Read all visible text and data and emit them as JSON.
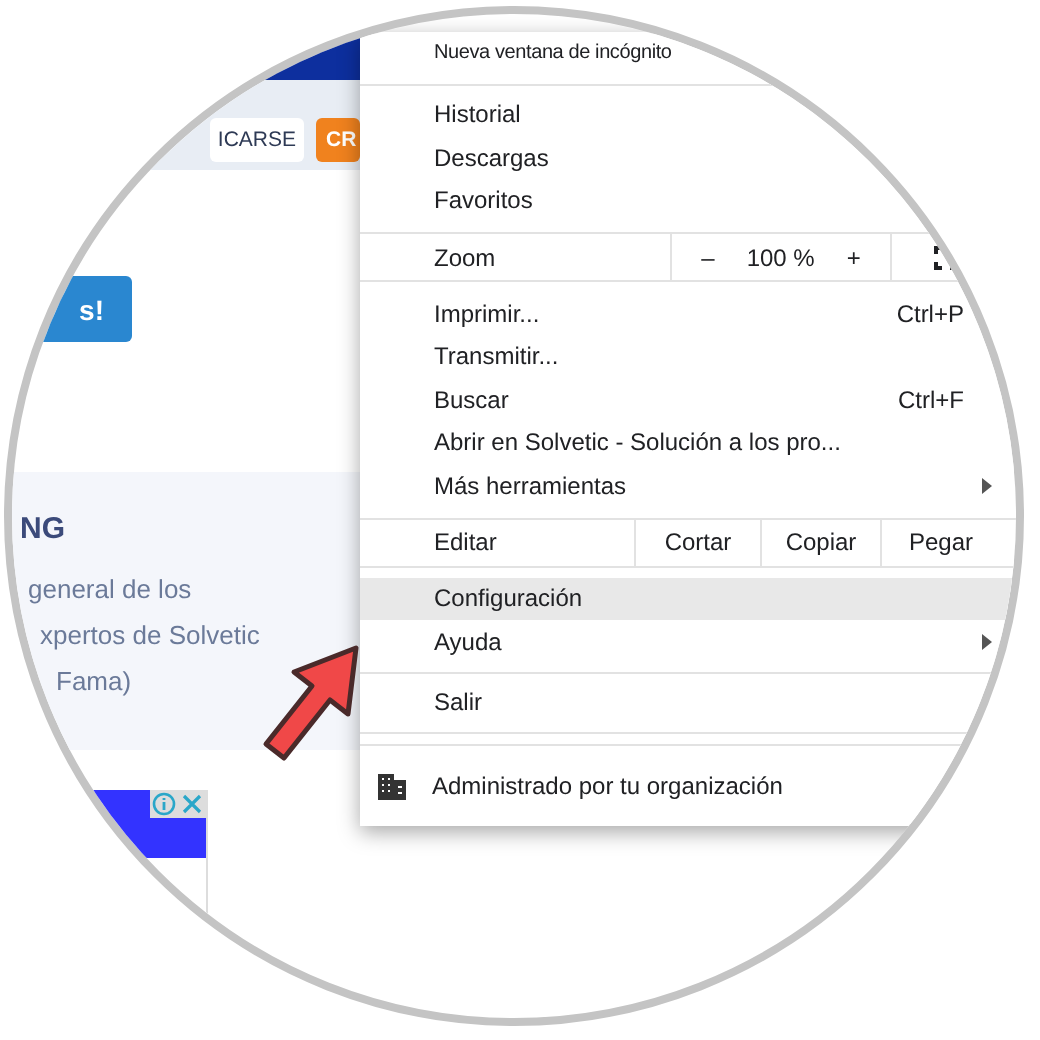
{
  "page": {
    "header_buttons": [
      {
        "label": "ICARSE",
        "kind": "outline"
      },
      {
        "label": "CR",
        "kind": "accent"
      }
    ],
    "cta_button": "s!",
    "panel": {
      "heading": "NG",
      "lines": [
        "general de los",
        "xpertos de Solvetic",
        "Fama)"
      ]
    }
  },
  "menu": {
    "items": [
      {
        "kind": "item",
        "label": "Nueva ventana de incógnito",
        "selected": false,
        "submenu": false
      },
      {
        "kind": "separator"
      },
      {
        "kind": "item",
        "label": "Historial",
        "selected": false,
        "submenu": false
      },
      {
        "kind": "item",
        "label": "Descargas",
        "selected": false,
        "submenu": false
      },
      {
        "kind": "item",
        "label": "Favoritos",
        "selected": false,
        "submenu": false
      },
      {
        "kind": "zoom",
        "label": "Zoom",
        "minus": "–",
        "value": "100 %",
        "plus": "+"
      },
      {
        "kind": "item",
        "label": "Imprimir...",
        "shortcut": "Ctrl+P",
        "selected": false,
        "submenu": false
      },
      {
        "kind": "item",
        "label": "Transmitir...",
        "selected": false,
        "submenu": false
      },
      {
        "kind": "item",
        "label": "Buscar",
        "shortcut": "Ctrl+F",
        "selected": false,
        "submenu": false
      },
      {
        "kind": "item",
        "label": "Abrir en Solvetic - Solución a los pro...",
        "selected": false,
        "submenu": false
      },
      {
        "kind": "item",
        "label": "Más herramientas",
        "selected": false,
        "submenu": true
      },
      {
        "kind": "edit",
        "label": "Editar",
        "actions": [
          "Cortar",
          "Copiar",
          "Pegar"
        ]
      },
      {
        "kind": "item",
        "label": "Configuración",
        "selected": true,
        "submenu": false
      },
      {
        "kind": "item",
        "label": "Ayuda",
        "selected": false,
        "submenu": true
      },
      {
        "kind": "separator"
      },
      {
        "kind": "item",
        "label": "Salir",
        "selected": false,
        "submenu": false
      },
      {
        "kind": "separator"
      },
      {
        "kind": "managed",
        "label": "Administrado por tu organización"
      }
    ]
  }
}
